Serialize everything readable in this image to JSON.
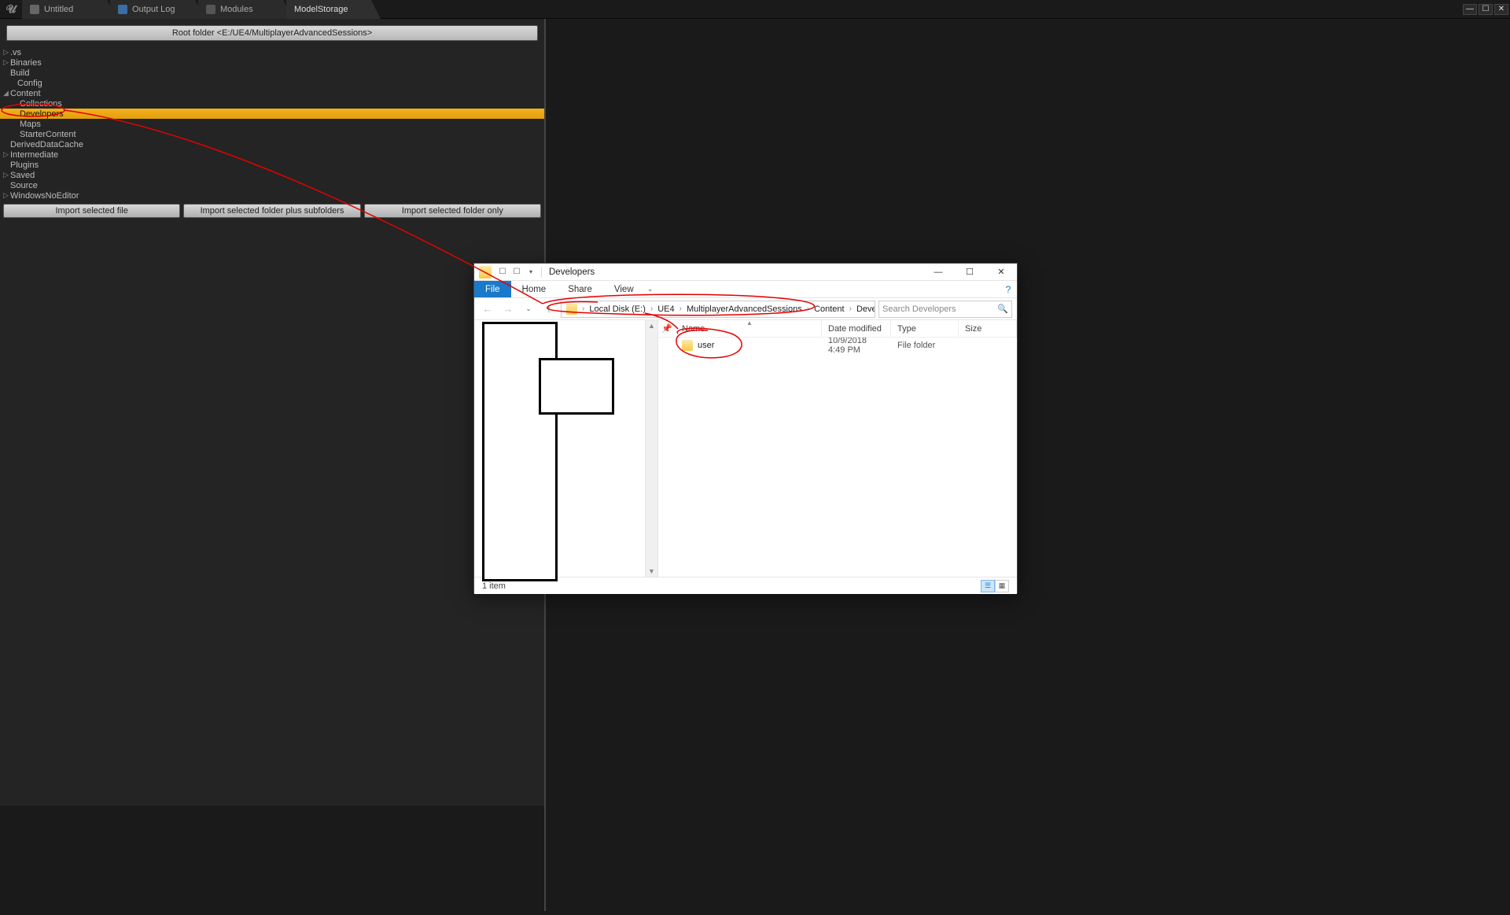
{
  "ue_tabs": [
    {
      "label": "Untitled",
      "icon": "doc-icon"
    },
    {
      "label": "Output Log",
      "icon": "log-icon"
    },
    {
      "label": "Modules",
      "icon": "modules-icon"
    },
    {
      "label": "ModelStorage",
      "icon": "storage-icon"
    }
  ],
  "root_folder_label": "Root folder <E:/UE4/MultiplayerAdvancedSessions>",
  "tree": [
    {
      "label": ".vs",
      "indent": 0,
      "arrow": "▷"
    },
    {
      "label": "Binaries",
      "indent": 0,
      "arrow": "▷"
    },
    {
      "label": "Build",
      "indent": 0,
      "arrow": ""
    },
    {
      "label": "Config",
      "indent": 0,
      "arrow": "",
      "pad": true
    },
    {
      "label": "Content",
      "indent": 0,
      "arrow": "◢"
    },
    {
      "label": "Collections",
      "indent": 1,
      "arrow": ""
    },
    {
      "label": "Developers",
      "indent": 1,
      "arrow": "",
      "selected": true
    },
    {
      "label": "Maps",
      "indent": 1,
      "arrow": ""
    },
    {
      "label": "StarterContent",
      "indent": 1,
      "arrow": ""
    },
    {
      "label": "DerivedDataCache",
      "indent": 0,
      "arrow": ""
    },
    {
      "label": "Intermediate",
      "indent": 0,
      "arrow": "▷"
    },
    {
      "label": "Plugins",
      "indent": 0,
      "arrow": ""
    },
    {
      "label": "Saved",
      "indent": 0,
      "arrow": "▷"
    },
    {
      "label": "Source",
      "indent": 0,
      "arrow": ""
    },
    {
      "label": "WindowsNoEditor",
      "indent": 0,
      "arrow": "▷"
    }
  ],
  "import_buttons": {
    "file": "Import selected file",
    "folder_sub": "Import selected folder plus subfolders",
    "folder_only": "Import selected folder only"
  },
  "explorer": {
    "title": "Developers",
    "ribbon": {
      "file": "File",
      "home": "Home",
      "share": "Share",
      "view": "View"
    },
    "breadcrumbs": [
      "Local Disk (E:)",
      "UE4",
      "MultiplayerAdvancedSessions",
      "Content",
      "Developers"
    ],
    "search_placeholder": "Search Developers",
    "columns": {
      "name": "Name",
      "date": "Date modified",
      "type": "Type",
      "size": "Size"
    },
    "row": {
      "name": "user",
      "date": "10/9/2018 4:49 PM",
      "type": "File folder",
      "size": ""
    },
    "status": "1 item"
  }
}
